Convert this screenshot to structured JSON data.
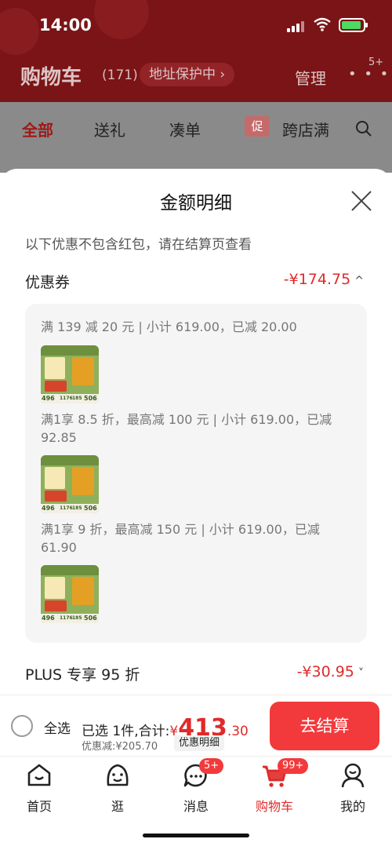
{
  "status": {
    "time": "14:00"
  },
  "header": {
    "title": "购物车",
    "count": "(171)",
    "address_pill": "地址保护中 ›",
    "manage": "管理",
    "more": "• • •",
    "more_badge": "5+"
  },
  "tabs": [
    {
      "label": "全部"
    },
    {
      "label": "送礼"
    },
    {
      "label": "凑单"
    },
    {
      "label": "跨店满",
      "badge": "促"
    }
  ],
  "sheet": {
    "title": "金额明细",
    "hint": "以下优惠不包含红包，请在结算页查看",
    "coupon": {
      "label": "优惠券",
      "amount": "-¥174.75",
      "chevron": "^"
    },
    "coupon_lines": [
      {
        "text": "满 139 减 20 元 | 小计 619.00，已减 20.00",
        "thumb_nums": [
          "496",
          "1176",
          "185",
          "506"
        ]
      },
      {
        "text": "满1享 8.5 折，最高减 100 元 | 小计 619.00，已减 92.85",
        "thumb_nums": [
          "496",
          "1176",
          "185",
          "506"
        ]
      },
      {
        "text": "满1享 9 折，最高减 150 元 | 小计 619.00，已减 61.90",
        "thumb_nums": [
          "496",
          "1176",
          "185",
          "506"
        ]
      }
    ],
    "plus": {
      "label": "PLUS 专享 95 折",
      "amount": "-¥30.95",
      "chevron": "˅"
    }
  },
  "checkout": {
    "select_all": "全选",
    "selected_text": "已选 1件,合计:",
    "price_symbol": "¥",
    "price_int": "413",
    "price_dec": ".30",
    "saved": "优惠减:¥205.70",
    "detail_button": "优惠明细",
    "pay_button": "去结算"
  },
  "tabbar": [
    {
      "label": "首页"
    },
    {
      "label": "逛"
    },
    {
      "label": "消息",
      "badge": "5+"
    },
    {
      "label": "购物车",
      "badge": "99+"
    },
    {
      "label": "我的"
    }
  ],
  "colors": {
    "accent": "#e02a2a",
    "header_bg": "#7a1416",
    "pay_button": "#f23a3c"
  }
}
